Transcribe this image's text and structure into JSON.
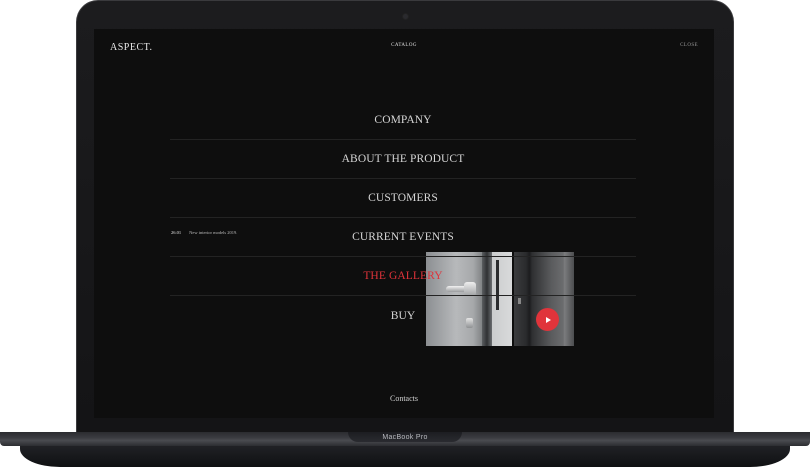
{
  "header": {
    "logo": "ASPECT.",
    "catalog_label": "CATALOG",
    "close_label": "CLOSE"
  },
  "menu": {
    "items": [
      {
        "label": "COMPANY",
        "active": false
      },
      {
        "label": "ABOUT THE PRODUCT",
        "active": false
      },
      {
        "label": "CUSTOMERS",
        "active": false
      },
      {
        "label": "CURRENT EVENTS",
        "active": false
      },
      {
        "label": "THE GALLERY",
        "active": true
      },
      {
        "label": "BUY",
        "active": false
      }
    ]
  },
  "news": {
    "date": "26.01",
    "text": "New interior models 2019."
  },
  "gallery_preview": {
    "play_icon": "play-icon"
  },
  "footer": {
    "contacts_label": "Contacts"
  },
  "device": {
    "label": "MacBook Pro"
  },
  "colors": {
    "accent": "#e0333a",
    "background": "#0e0e0e",
    "text": "#d6d6d6"
  }
}
